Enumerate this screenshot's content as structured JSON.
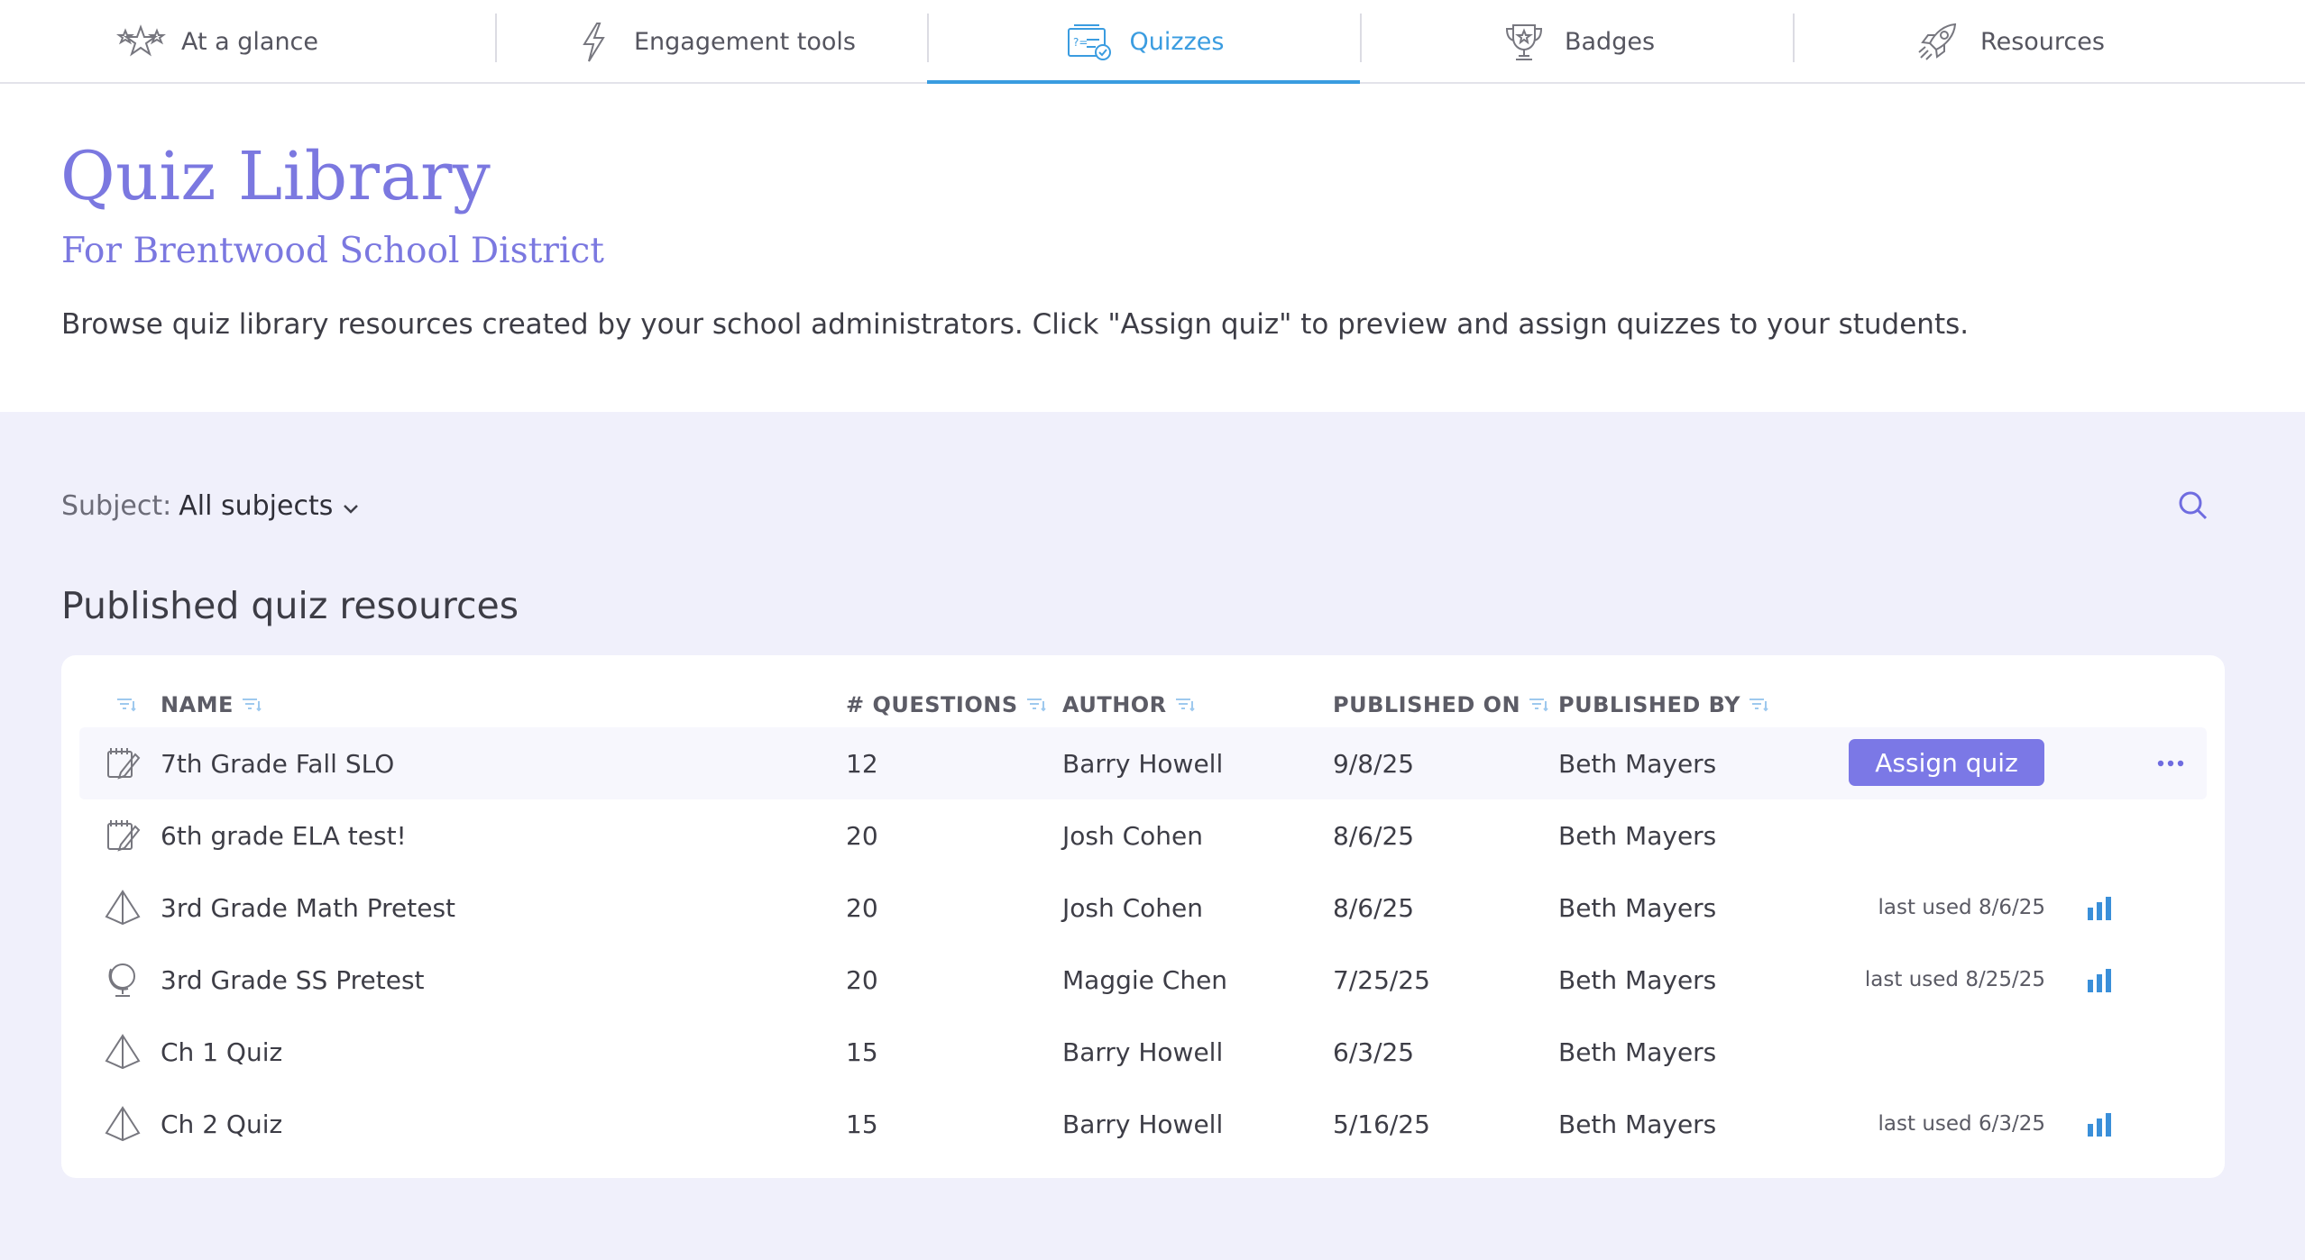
{
  "nav": {
    "tabs": [
      {
        "label": "At a glance",
        "icon": "stars-icon",
        "active": false
      },
      {
        "label": "Engagement tools",
        "icon": "lightning-icon",
        "active": false
      },
      {
        "label": "Quizzes",
        "icon": "quiz-icon",
        "active": true
      },
      {
        "label": "Badges",
        "icon": "trophy-icon",
        "active": false
      },
      {
        "label": "Resources",
        "icon": "rocket-icon",
        "active": false
      }
    ]
  },
  "header": {
    "title": "Quiz Library",
    "subtitle": "For Brentwood School District",
    "description": "Browse quiz library resources created by your school administrators. Click \"Assign quiz\" to preview and assign quizzes to your students."
  },
  "filter": {
    "label": "Subject:",
    "value": "All subjects"
  },
  "section": {
    "title": "Published quiz resources"
  },
  "table": {
    "columns": {
      "name": "NAME",
      "questions": "# QUESTIONS",
      "author": "AUTHOR",
      "published_on": "PUBLISHED ON",
      "published_by": "PUBLISHED BY"
    },
    "assign_label": "Assign quiz",
    "rows": [
      {
        "icon": "notepad-icon",
        "name": "7th Grade Fall SLO",
        "questions": "12",
        "author": "Barry Howell",
        "published_on": "9/8/25",
        "published_by": "Beth Mayers",
        "last_used": "",
        "highlighted": true
      },
      {
        "icon": "notepad-icon",
        "name": "6th grade ELA test!",
        "questions": "20",
        "author": "Josh Cohen",
        "published_on": "8/6/25",
        "published_by": "Beth Mayers",
        "last_used": "",
        "highlighted": false
      },
      {
        "icon": "pyramid-icon",
        "name": "3rd Grade Math Pretest",
        "questions": "20",
        "author": "Josh Cohen",
        "published_on": "8/6/25",
        "published_by": "Beth Mayers",
        "last_used": "last used 8/6/25",
        "highlighted": false
      },
      {
        "icon": "globe-icon",
        "name": "3rd Grade SS Pretest",
        "questions": "20",
        "author": "Maggie Chen",
        "published_on": "7/25/25",
        "published_by": "Beth Mayers",
        "last_used": "last used 8/25/25",
        "highlighted": false
      },
      {
        "icon": "pyramid-icon",
        "name": "Ch 1 Quiz",
        "questions": "15",
        "author": "Barry Howell",
        "published_on": "6/3/25",
        "published_by": "Beth Mayers",
        "last_used": "",
        "highlighted": false
      },
      {
        "icon": "pyramid-icon",
        "name": "Ch 2 Quiz",
        "questions": "15",
        "author": "Barry Howell",
        "published_on": "5/16/25",
        "published_by": "Beth Mayers",
        "last_used": "last used 6/3/25",
        "highlighted": false
      }
    ]
  },
  "colors": {
    "accent": "#7b78e0",
    "active_tab": "#3a9ce0",
    "button": "#7b78e6",
    "stats": "#3a8fd9",
    "page_bg": "#f0f0fb"
  }
}
